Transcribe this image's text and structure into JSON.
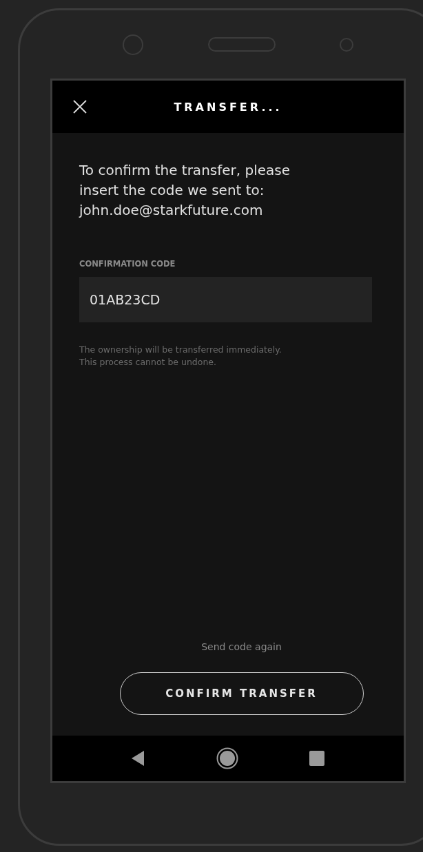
{
  "header": {
    "title": "TRANSFER..."
  },
  "message_lines": [
    "To confirm the transfer, please",
    "insert the code we sent to:",
    "john.doe@starkfuture.com"
  ],
  "code_field": {
    "label": "CONFIRMATION CODE",
    "value": "01AB23CD"
  },
  "note_lines": [
    "The ownership will be transferred immediately.",
    "This process cannot be undone."
  ],
  "resend_link": "Send code again",
  "confirm_button": "CONFIRM TRANSFER"
}
